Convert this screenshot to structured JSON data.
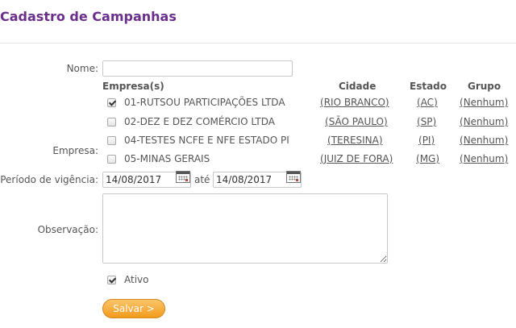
{
  "page_title": "Cadastro de Campanhas",
  "form": {
    "nome_label": "Nome:",
    "nome_value": "",
    "empresa_label": "Empresa:",
    "table_headers": {
      "empresas": "Empresa(s)",
      "cidade": "Cidade",
      "estado": "Estado",
      "grupo": "Grupo"
    },
    "companies": [
      {
        "checked": true,
        "name": "01-RUTSOU PARTICIPAÇÕES LTDA",
        "city": "RIO BRANCO",
        "state": "AC",
        "group": "Nenhum"
      },
      {
        "checked": false,
        "name": "02-DEZ E DEZ COMÉRCIO LTDA",
        "city": "SÃO PAULO",
        "state": "SP",
        "group": "Nenhum"
      },
      {
        "checked": false,
        "name": "04-TESTES NCFE E NFE ESTADO PI",
        "city": "TERESINA",
        "state": "PI",
        "group": "Nenhum"
      },
      {
        "checked": false,
        "name": "05-MINAS GERAIS",
        "city": "JUIZ DE FORA",
        "state": "MG",
        "group": "Nenhum"
      }
    ],
    "periodo_label": "Período de vigência:",
    "date_start": "14/08/2017",
    "date_connector": "até",
    "date_end": "14/08/2017",
    "observacao_label": "Observação:",
    "observacao_value": "",
    "ativo_label": "Ativo",
    "ativo_checked": true,
    "save_label": "Salvar >"
  },
  "colors": {
    "title": "#6a2f8a",
    "button": "#f29b1c"
  }
}
